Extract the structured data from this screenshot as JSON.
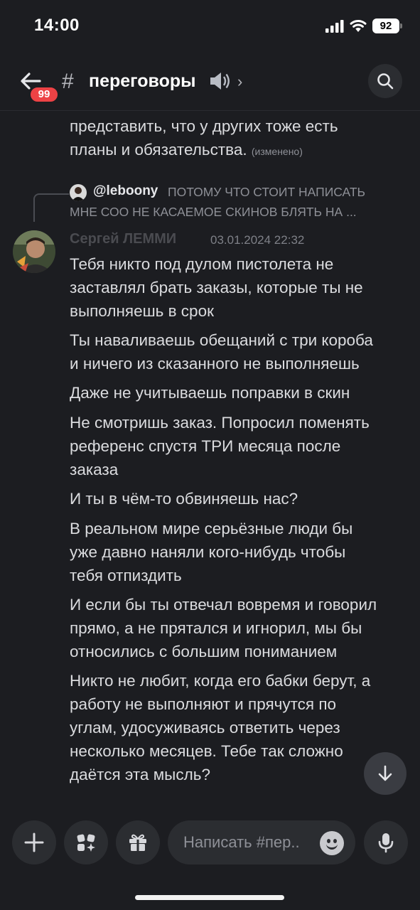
{
  "status": {
    "time": "14:00",
    "battery": "92"
  },
  "header": {
    "unread_count": "99",
    "channel_name": "переговоры",
    "channel_emoji_icon": "speaker-icon",
    "chevron": "›"
  },
  "messages": {
    "previous_tail": {
      "line1": "представить, что у других тоже есть",
      "line2": "планы и обязательства.",
      "edited_label": "(изменено)"
    },
    "reply": {
      "author": "@leboony",
      "preview_line1": "ПОТОМУ ЧТО СТОИТ НАПИСАТЬ",
      "preview_line2": "МНЕ СОО НЕ КАСАЕМОЕ СКИНОВ БЛЯТЬ НА ..."
    },
    "author": "Сергей ЛЕММИ",
    "timestamp": "03.01.2024 22:32",
    "lines": [
      "Тебя никто под дулом пистолета не",
      "заставлял брать заказы, которые ты не",
      "выполняешь в срок",
      "Ты наваливаешь обещаний с три короба",
      "и ничего из сказанного не выполняешь",
      "Даже не учитываешь поправки в скин",
      "Не смотришь заказ. Попросил поменять",
      "референс спустя ТРИ месяца после",
      "заказа",
      "И ты в чём-то обвиняешь нас?",
      "В реальном мире серьёзные люди бы",
      "уже давно наняли кого-нибудь чтобы",
      "тебя отпиздить",
      "И если бы ты отвечал вовремя и говорил",
      "прямо, а не прятался и игнорил, мы бы",
      "относились с большим пониманием",
      "Никто не любит, когда его бабки берут, а",
      "работу не выполняют и прячутся по",
      "углам, удосуживаясь ответить через",
      "несколько месяцев. Тебе так сложно",
      "даётся эта мысль?"
    ]
  },
  "composer": {
    "placeholder": "Написать #пер..",
    "buttons": [
      "plus-icon",
      "apps-icon",
      "gift-icon",
      "emoji-icon",
      "mic-icon"
    ]
  },
  "colors": {
    "background": "#1c1d21",
    "badge": "#ed4245",
    "surface": "#2b2d31"
  }
}
